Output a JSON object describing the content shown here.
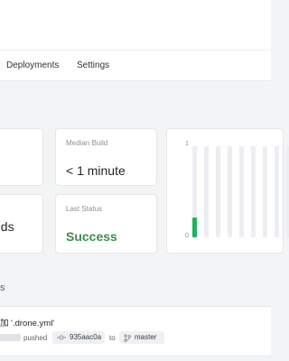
{
  "tabs": [
    {
      "label": "Deployments"
    },
    {
      "label": "Settings"
    }
  ],
  "cards": {
    "left_top": {
      "value": ""
    },
    "left_bottom": {
      "value": "nds"
    },
    "median_build": {
      "label": "Median Build",
      "value": "< 1 minute"
    },
    "last_status": {
      "label": "Last Status",
      "value": "Success",
      "color": "#3a8f4a"
    }
  },
  "chart_data": {
    "type": "bar",
    "ylim": [
      0,
      1
    ],
    "y_ticks": [
      "1",
      "0"
    ],
    "values": [
      0.22,
      0,
      0,
      0,
      0,
      0,
      0,
      0,
      0
    ],
    "bar_color": "#1fb55a",
    "track_color": "#eceef1"
  },
  "section": {
    "label_fragment": "s"
  },
  "build": {
    "message": "加 '.drone.yml'",
    "author_redacted": true,
    "action": "pushed",
    "commit": "935aac0a",
    "to_word": "to",
    "branch": "master"
  },
  "icons": {
    "commit": "commit-icon",
    "branch": "branch-icon"
  }
}
